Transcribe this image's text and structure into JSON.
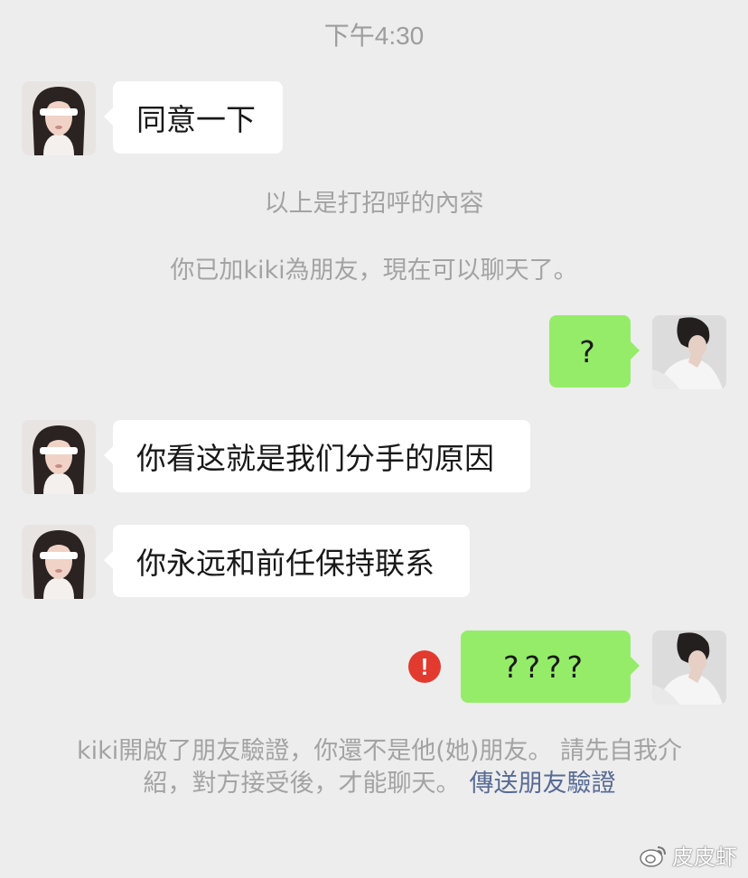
{
  "chat": {
    "time": "下午4:30",
    "messages": [
      {
        "side": "left",
        "text": "同意一下"
      },
      {
        "side": "right",
        "text": "?"
      },
      {
        "side": "left",
        "text": "你看这就是我们分手的原因"
      },
      {
        "side": "left",
        "text": "你永远和前任保持联系"
      },
      {
        "side": "right",
        "text": "????",
        "status": "failed"
      }
    ],
    "system": {
      "greeting_note": "以上是打招呼的內容",
      "added_friend": "你已加kiki為朋友，現在可以聊天了。",
      "verification_notice": "kiki開啟了朋友驗證，你還不是他(她)朋友。 請先自我介紹，對方接受後，才能聊天。",
      "verification_link": "傳送朋友驗證"
    }
  },
  "icons": {
    "error": "exclamation-circle-icon",
    "watermark": "weibo-logo-icon"
  },
  "watermark": {
    "text": "皮皮虾"
  },
  "colors": {
    "background": "#ededed",
    "incoming_bubble": "#ffffff",
    "outgoing_bubble": "#95ec69",
    "system_text": "#a3a3a3",
    "link": "#576b95",
    "error": "#e33a2f"
  }
}
